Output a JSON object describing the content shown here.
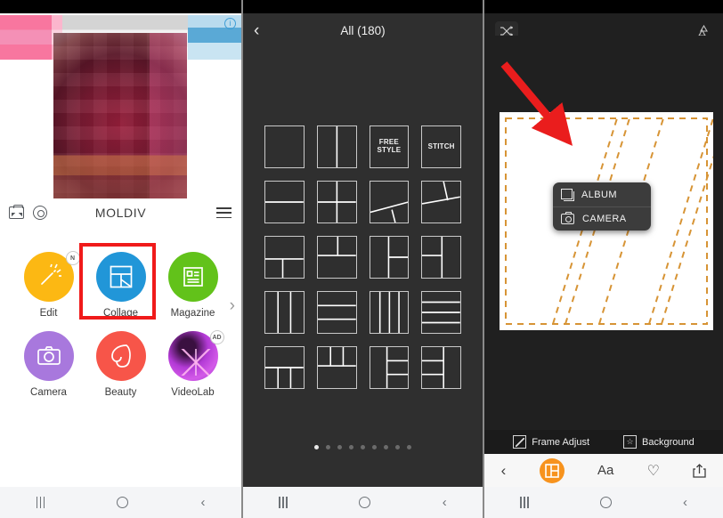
{
  "app": {
    "name": "MOLDIV",
    "accent_orange": "#f7931e",
    "highlight_red": "#f01a1a",
    "dash_orange": "#d79435"
  },
  "panel1": {
    "title": "MOLDIV",
    "icons": {
      "ticket": "ticket-icon",
      "disc": "disc-icon",
      "menu": "hamburger-icon",
      "info": "info-icon",
      "info_glyph": "i"
    },
    "apps": [
      {
        "label": "Edit",
        "badge": "N",
        "icon": "magic-wand-icon",
        "color": "#fcb813",
        "highlighted": false
      },
      {
        "label": "Collage",
        "badge": "",
        "icon": "collage-icon",
        "color": "#2196d8",
        "highlighted": true
      },
      {
        "label": "Magazine",
        "badge": "",
        "icon": "magazine-icon",
        "color": "#62c21a",
        "highlighted": false
      },
      {
        "label": "Camera",
        "badge": "",
        "icon": "camera-icon",
        "color": "#a878dd",
        "highlighted": false
      },
      {
        "label": "Beauty",
        "badge": "",
        "icon": "face-icon",
        "color": "#f75549",
        "highlighted": false
      },
      {
        "label": "VideoLab",
        "badge": "AD",
        "icon": "videolab-icon",
        "color": "#b33ad6",
        "highlighted": false
      }
    ],
    "next_chevron": "›"
  },
  "panel2": {
    "title": "All (180)",
    "back": "‹",
    "layouts": [
      [
        {
          "type": "single"
        },
        {
          "type": "v2"
        },
        {
          "type": "text",
          "label": "FREE\nSTYLE"
        },
        {
          "type": "text",
          "label": "STITCH"
        }
      ],
      [
        {
          "type": "h2"
        },
        {
          "type": "grid4"
        },
        {
          "type": "diag-a"
        },
        {
          "type": "diag-b"
        }
      ],
      [
        {
          "type": "top-split-bottom2"
        },
        {
          "type": "top2-bottom"
        },
        {
          "type": "left-right2"
        },
        {
          "type": "left2-right"
        }
      ],
      [
        {
          "type": "v3"
        },
        {
          "type": "h3"
        },
        {
          "type": "v4"
        },
        {
          "type": "h4"
        }
      ],
      [
        {
          "type": "top-bottom3"
        },
        {
          "type": "top3-bottom"
        },
        {
          "type": "leftbig-right3"
        },
        {
          "type": "left3-rightbig"
        }
      ]
    ],
    "page_dots": {
      "count": 9,
      "active_index": 0
    }
  },
  "panel3": {
    "shuffle_icon": "shuffle-icon",
    "recycle_icon": "recycle-icon",
    "popup": {
      "items": [
        {
          "label": "ALBUM",
          "icon": "album-icon"
        },
        {
          "label": "CAMERA",
          "icon": "camera-icon"
        }
      ]
    },
    "tools": [
      {
        "label": "Frame Adjust",
        "icon": "frame-adjust-icon"
      },
      {
        "label": "Background",
        "icon": "background-star-icon"
      }
    ],
    "bottom_bar": [
      {
        "name": "back",
        "glyph": "‹",
        "icon": "chevron-left-icon",
        "active": false
      },
      {
        "name": "layout",
        "glyph": "",
        "icon": "layout-grid-icon",
        "active": true
      },
      {
        "name": "text",
        "glyph": "Aa",
        "icon": "text-icon",
        "active": false
      },
      {
        "name": "sticker",
        "glyph": "♡",
        "icon": "heart-icon",
        "active": false
      },
      {
        "name": "share",
        "glyph": "",
        "icon": "share-icon",
        "active": false
      }
    ]
  },
  "navbar": {
    "recents": "recents-icon",
    "home": "home-icon",
    "back": "‹"
  }
}
